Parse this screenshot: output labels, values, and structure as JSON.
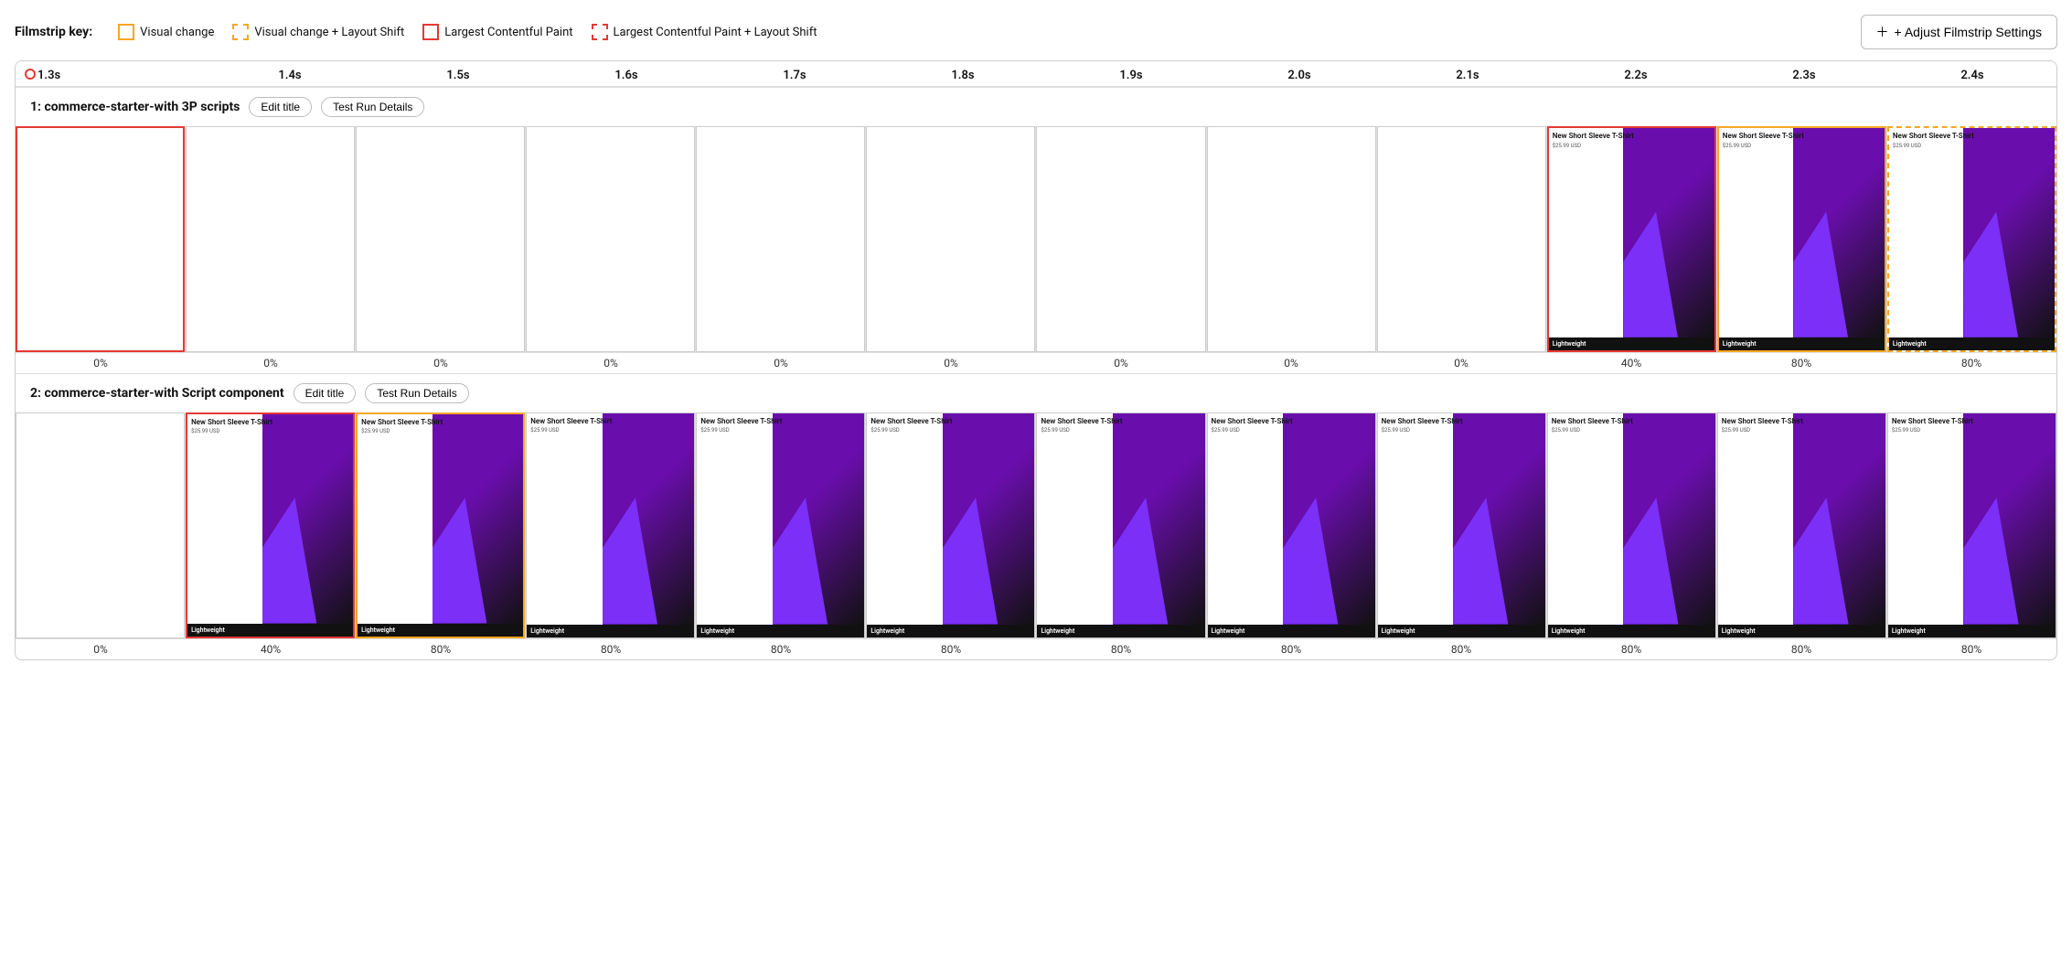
{
  "legend": {
    "key_label": "Filmstrip key:",
    "items": [
      {
        "id": "visual-change",
        "box_class": "yellow-solid",
        "label": "Visual change"
      },
      {
        "id": "visual-change-layout-shift",
        "box_class": "yellow-dashed",
        "label": "Visual change + Layout Shift"
      },
      {
        "id": "lcp",
        "box_class": "red-solid",
        "label": "Largest Contentful Paint"
      },
      {
        "id": "lcp-layout-shift",
        "box_class": "red-dashed",
        "label": "Largest Contentful Paint + Layout Shift"
      }
    ],
    "adjust_button": "+ Adjust Filmstrip Settings"
  },
  "timeline": {
    "ticks": [
      "1.3s",
      "1.4s",
      "1.5s",
      "1.6s",
      "1.7s",
      "1.8s",
      "1.9s",
      "2.0s",
      "2.1s",
      "2.2s",
      "2.3s",
      "2.4s"
    ]
  },
  "rows": [
    {
      "id": "row1",
      "title": "1: commerce-starter-with 3P scripts",
      "edit_title_label": "Edit title",
      "test_run_label": "Test Run Details",
      "frames": [
        {
          "border": "red-solid",
          "has_content": false,
          "percent": "0%"
        },
        {
          "border": "none",
          "has_content": false,
          "percent": "0%"
        },
        {
          "border": "none",
          "has_content": false,
          "percent": "0%"
        },
        {
          "border": "none",
          "has_content": false,
          "percent": "0%"
        },
        {
          "border": "none",
          "has_content": false,
          "percent": "0%"
        },
        {
          "border": "none",
          "has_content": false,
          "percent": "0%"
        },
        {
          "border": "none",
          "has_content": false,
          "percent": "0%"
        },
        {
          "border": "none",
          "has_content": false,
          "percent": "0%"
        },
        {
          "border": "none",
          "has_content": false,
          "percent": "0%"
        },
        {
          "border": "red-solid",
          "has_content": true,
          "percent": "40%"
        },
        {
          "border": "yellow-solid",
          "has_content": true,
          "percent": "80%"
        },
        {
          "border": "yellow-dashed",
          "has_content": true,
          "percent": "80%"
        }
      ]
    },
    {
      "id": "row2",
      "title": "2: commerce-starter-with Script component",
      "edit_title_label": "Edit title",
      "test_run_label": "Test Run Details",
      "frames": [
        {
          "border": "none",
          "has_content": false,
          "percent": "0%"
        },
        {
          "border": "red-solid",
          "has_content": true,
          "percent": "40%"
        },
        {
          "border": "yellow-solid",
          "has_content": true,
          "percent": "80%"
        },
        {
          "border": "none",
          "has_content": true,
          "percent": "80%"
        },
        {
          "border": "none",
          "has_content": true,
          "percent": "80%"
        },
        {
          "border": "none",
          "has_content": true,
          "percent": "80%"
        },
        {
          "border": "none",
          "has_content": true,
          "percent": "80%"
        },
        {
          "border": "none",
          "has_content": true,
          "percent": "80%"
        },
        {
          "border": "none",
          "has_content": true,
          "percent": "80%"
        },
        {
          "border": "none",
          "has_content": true,
          "percent": "80%"
        },
        {
          "border": "none",
          "has_content": true,
          "percent": "80%"
        },
        {
          "border": "none",
          "has_content": true,
          "percent": "80%"
        }
      ]
    }
  ],
  "product": {
    "name": "New Short Sleeve T-Shirt",
    "price": "$25.99 USD",
    "cta": "Lightweight"
  }
}
